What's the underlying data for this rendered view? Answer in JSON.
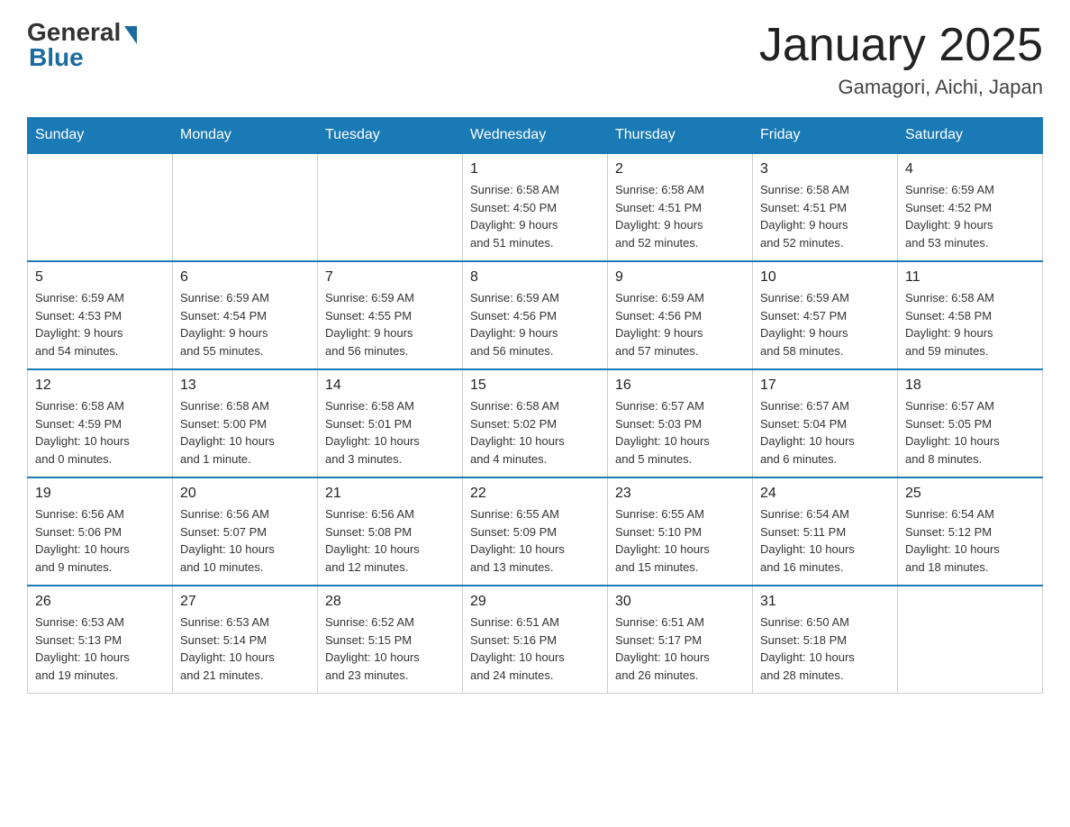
{
  "header": {
    "logo_general": "General",
    "logo_blue": "Blue",
    "month_title": "January 2025",
    "location": "Gamagori, Aichi, Japan"
  },
  "weekdays": [
    "Sunday",
    "Monday",
    "Tuesday",
    "Wednesday",
    "Thursday",
    "Friday",
    "Saturday"
  ],
  "weeks": [
    [
      {
        "day": "",
        "info": ""
      },
      {
        "day": "",
        "info": ""
      },
      {
        "day": "",
        "info": ""
      },
      {
        "day": "1",
        "info": "Sunrise: 6:58 AM\nSunset: 4:50 PM\nDaylight: 9 hours\nand 51 minutes."
      },
      {
        "day": "2",
        "info": "Sunrise: 6:58 AM\nSunset: 4:51 PM\nDaylight: 9 hours\nand 52 minutes."
      },
      {
        "day": "3",
        "info": "Sunrise: 6:58 AM\nSunset: 4:51 PM\nDaylight: 9 hours\nand 52 minutes."
      },
      {
        "day": "4",
        "info": "Sunrise: 6:59 AM\nSunset: 4:52 PM\nDaylight: 9 hours\nand 53 minutes."
      }
    ],
    [
      {
        "day": "5",
        "info": "Sunrise: 6:59 AM\nSunset: 4:53 PM\nDaylight: 9 hours\nand 54 minutes."
      },
      {
        "day": "6",
        "info": "Sunrise: 6:59 AM\nSunset: 4:54 PM\nDaylight: 9 hours\nand 55 minutes."
      },
      {
        "day": "7",
        "info": "Sunrise: 6:59 AM\nSunset: 4:55 PM\nDaylight: 9 hours\nand 56 minutes."
      },
      {
        "day": "8",
        "info": "Sunrise: 6:59 AM\nSunset: 4:56 PM\nDaylight: 9 hours\nand 56 minutes."
      },
      {
        "day": "9",
        "info": "Sunrise: 6:59 AM\nSunset: 4:56 PM\nDaylight: 9 hours\nand 57 minutes."
      },
      {
        "day": "10",
        "info": "Sunrise: 6:59 AM\nSunset: 4:57 PM\nDaylight: 9 hours\nand 58 minutes."
      },
      {
        "day": "11",
        "info": "Sunrise: 6:58 AM\nSunset: 4:58 PM\nDaylight: 9 hours\nand 59 minutes."
      }
    ],
    [
      {
        "day": "12",
        "info": "Sunrise: 6:58 AM\nSunset: 4:59 PM\nDaylight: 10 hours\nand 0 minutes."
      },
      {
        "day": "13",
        "info": "Sunrise: 6:58 AM\nSunset: 5:00 PM\nDaylight: 10 hours\nand 1 minute."
      },
      {
        "day": "14",
        "info": "Sunrise: 6:58 AM\nSunset: 5:01 PM\nDaylight: 10 hours\nand 3 minutes."
      },
      {
        "day": "15",
        "info": "Sunrise: 6:58 AM\nSunset: 5:02 PM\nDaylight: 10 hours\nand 4 minutes."
      },
      {
        "day": "16",
        "info": "Sunrise: 6:57 AM\nSunset: 5:03 PM\nDaylight: 10 hours\nand 5 minutes."
      },
      {
        "day": "17",
        "info": "Sunrise: 6:57 AM\nSunset: 5:04 PM\nDaylight: 10 hours\nand 6 minutes."
      },
      {
        "day": "18",
        "info": "Sunrise: 6:57 AM\nSunset: 5:05 PM\nDaylight: 10 hours\nand 8 minutes."
      }
    ],
    [
      {
        "day": "19",
        "info": "Sunrise: 6:56 AM\nSunset: 5:06 PM\nDaylight: 10 hours\nand 9 minutes."
      },
      {
        "day": "20",
        "info": "Sunrise: 6:56 AM\nSunset: 5:07 PM\nDaylight: 10 hours\nand 10 minutes."
      },
      {
        "day": "21",
        "info": "Sunrise: 6:56 AM\nSunset: 5:08 PM\nDaylight: 10 hours\nand 12 minutes."
      },
      {
        "day": "22",
        "info": "Sunrise: 6:55 AM\nSunset: 5:09 PM\nDaylight: 10 hours\nand 13 minutes."
      },
      {
        "day": "23",
        "info": "Sunrise: 6:55 AM\nSunset: 5:10 PM\nDaylight: 10 hours\nand 15 minutes."
      },
      {
        "day": "24",
        "info": "Sunrise: 6:54 AM\nSunset: 5:11 PM\nDaylight: 10 hours\nand 16 minutes."
      },
      {
        "day": "25",
        "info": "Sunrise: 6:54 AM\nSunset: 5:12 PM\nDaylight: 10 hours\nand 18 minutes."
      }
    ],
    [
      {
        "day": "26",
        "info": "Sunrise: 6:53 AM\nSunset: 5:13 PM\nDaylight: 10 hours\nand 19 minutes."
      },
      {
        "day": "27",
        "info": "Sunrise: 6:53 AM\nSunset: 5:14 PM\nDaylight: 10 hours\nand 21 minutes."
      },
      {
        "day": "28",
        "info": "Sunrise: 6:52 AM\nSunset: 5:15 PM\nDaylight: 10 hours\nand 23 minutes."
      },
      {
        "day": "29",
        "info": "Sunrise: 6:51 AM\nSunset: 5:16 PM\nDaylight: 10 hours\nand 24 minutes."
      },
      {
        "day": "30",
        "info": "Sunrise: 6:51 AM\nSunset: 5:17 PM\nDaylight: 10 hours\nand 26 minutes."
      },
      {
        "day": "31",
        "info": "Sunrise: 6:50 AM\nSunset: 5:18 PM\nDaylight: 10 hours\nand 28 minutes."
      },
      {
        "day": "",
        "info": ""
      }
    ]
  ]
}
